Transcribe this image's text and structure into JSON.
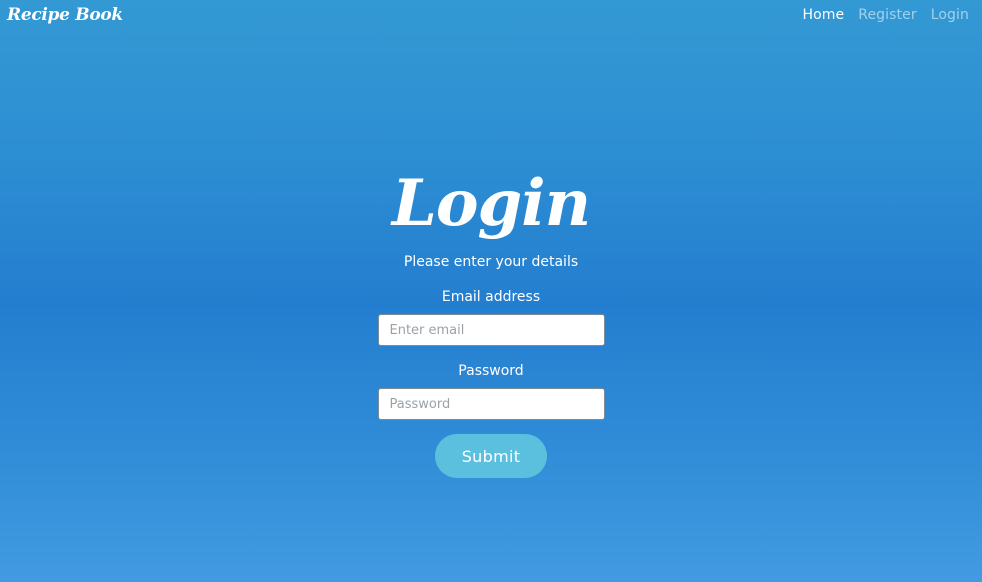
{
  "navbar": {
    "brand": "Recipe Book",
    "links": [
      {
        "label": "Home",
        "active": true
      },
      {
        "label": "Register",
        "active": false
      },
      {
        "label": "Login",
        "active": false
      }
    ]
  },
  "login": {
    "title": "Login",
    "subtitle": "Please enter your details",
    "email_label": "Email address",
    "email_placeholder": "Enter email",
    "password_label": "Password",
    "password_placeholder": "Password",
    "submit_label": "Submit"
  },
  "colors": {
    "background_top": "#3399d3",
    "background_mid": "#247ecf",
    "background_bottom": "#429be2",
    "submit_button": "#5bc0de"
  }
}
